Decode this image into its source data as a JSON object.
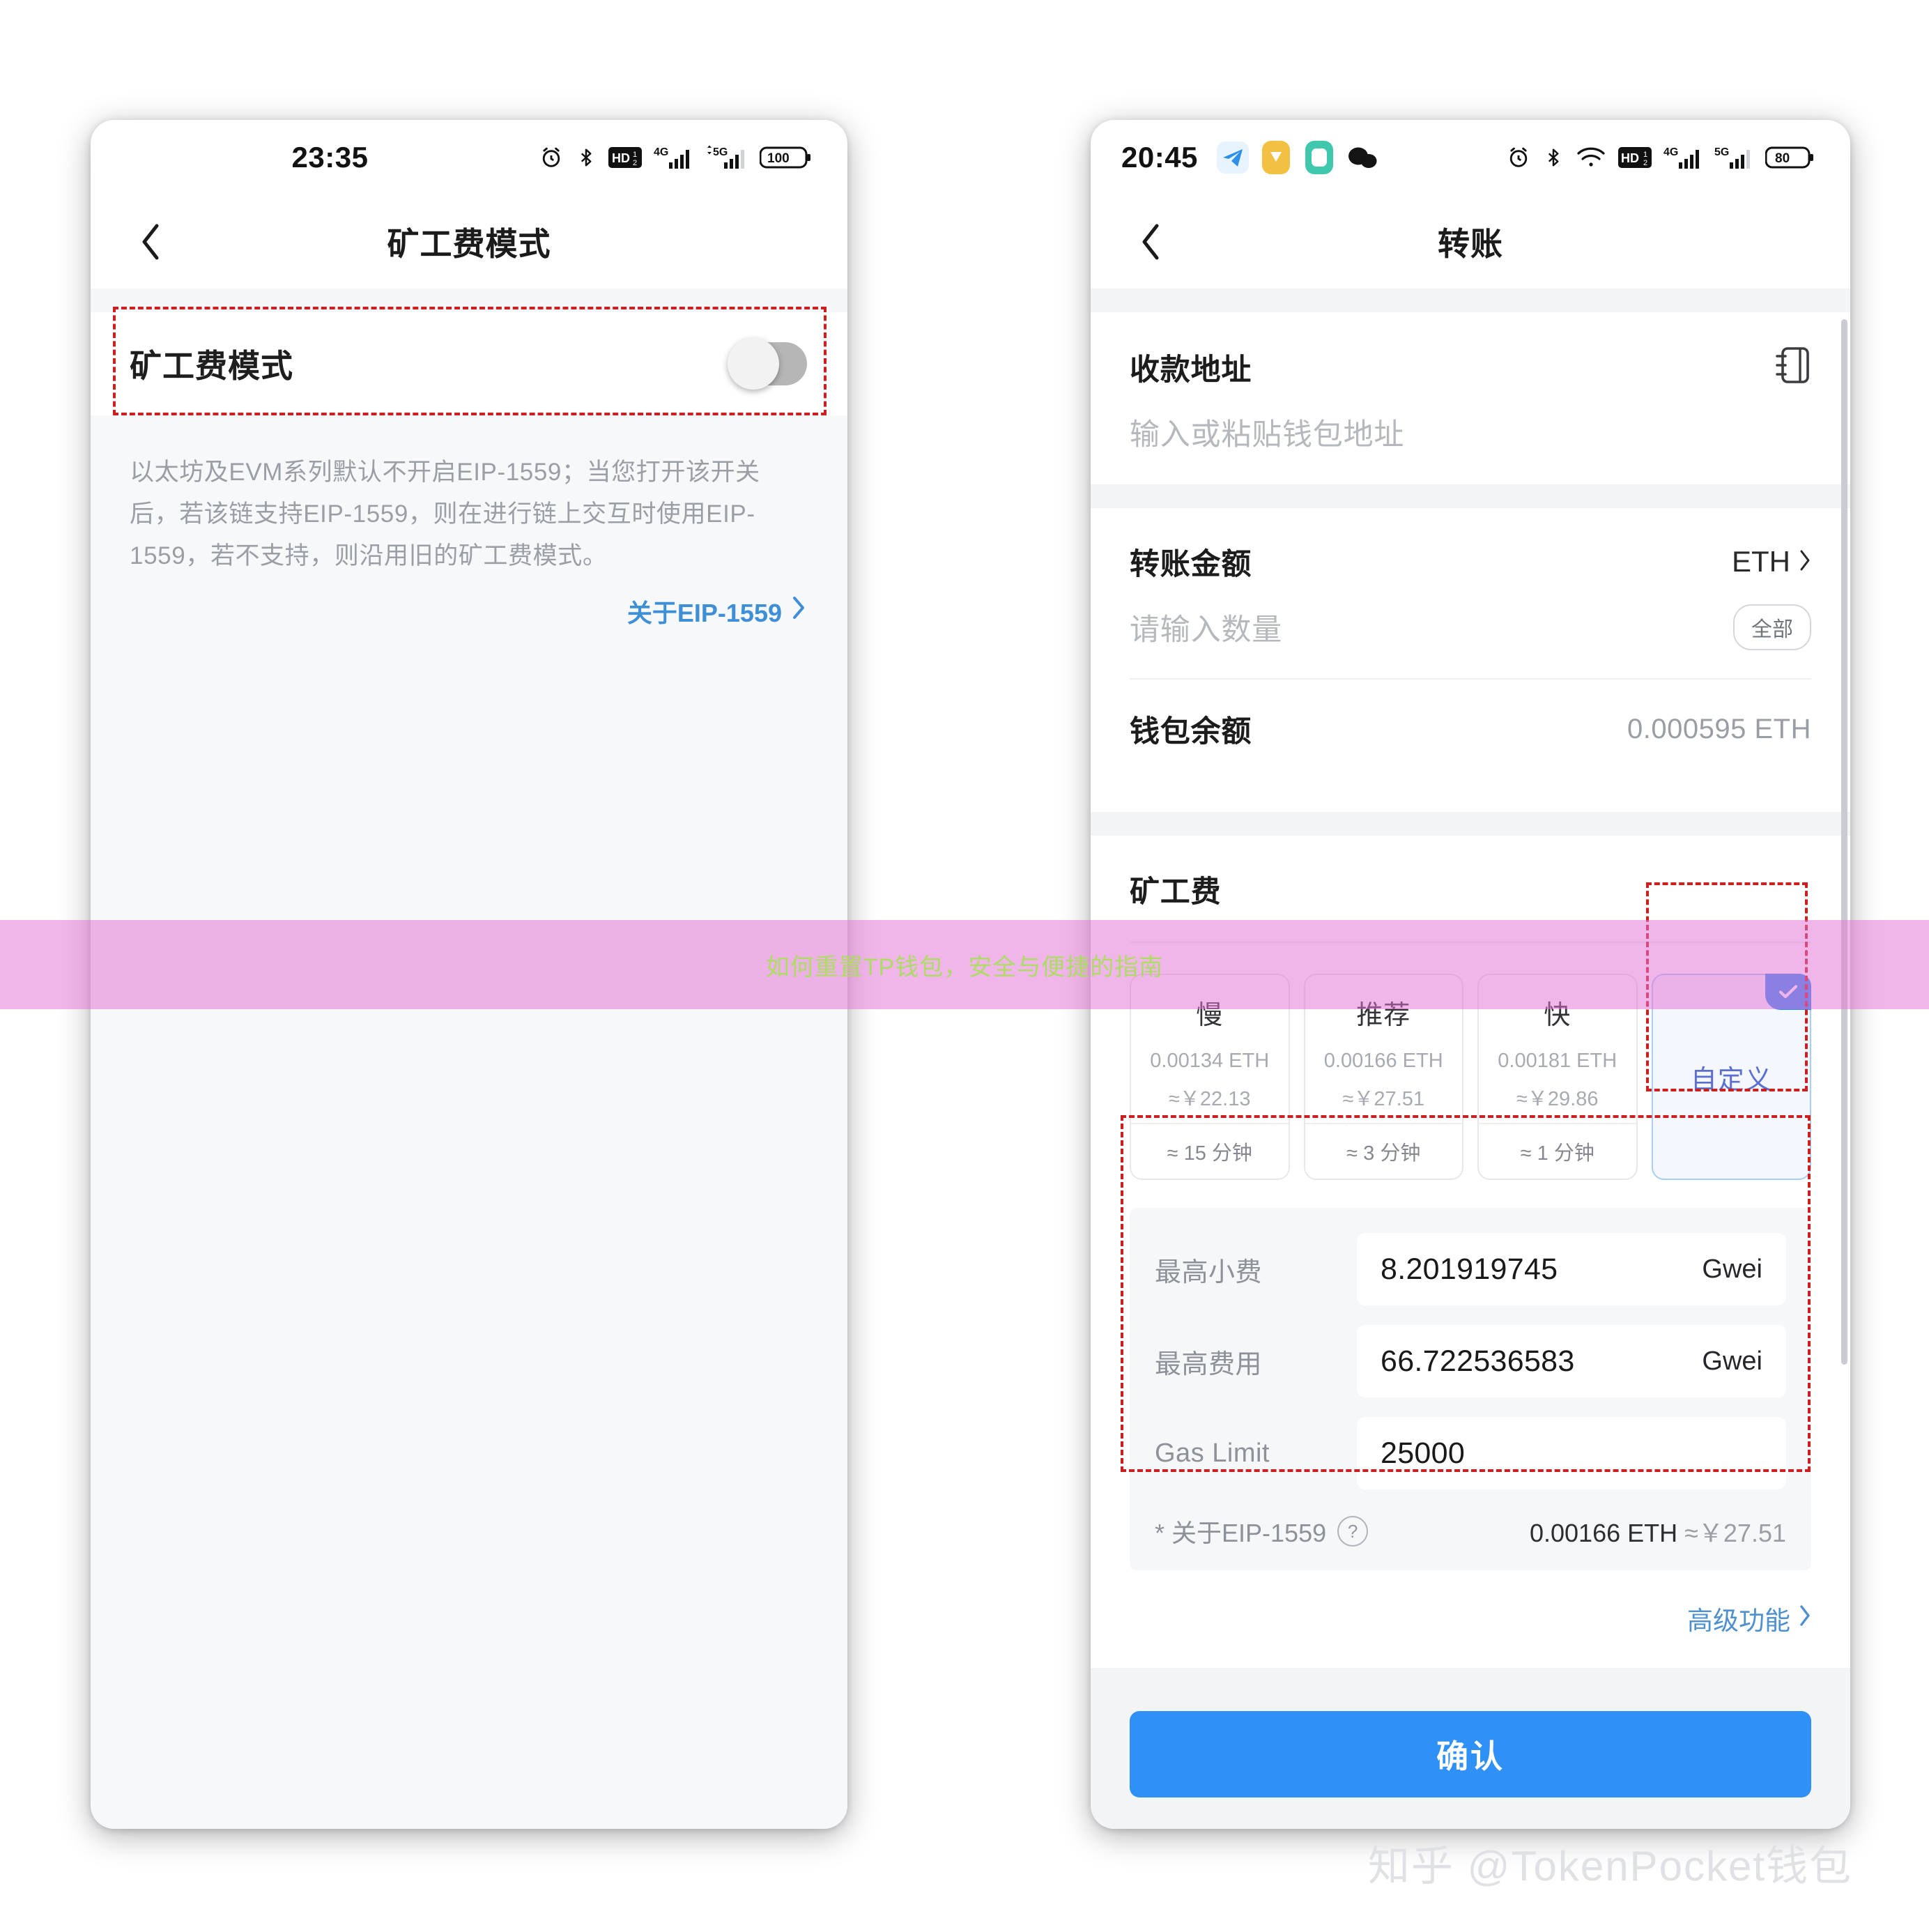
{
  "left_phone": {
    "status_bar": {
      "time": "23:35",
      "icons": [
        "alarm-icon",
        "bluetooth-icon",
        "hd-voice-icon",
        "4g-signal-icon",
        "5g-signal-icon"
      ],
      "battery": "100"
    },
    "nav": {
      "back_icon": "chevron-left-icon",
      "title": "矿工费模式"
    },
    "setting": {
      "label": "矿工费模式",
      "toggle_state": "off"
    },
    "description": "以太坊及EVM系列默认不开启EIP-1559；当您打开该开关后，若该链支持EIP-1559，则在进行链上交互时使用EIP-1559，若不支持，则沿用旧的矿工费模式。",
    "link": {
      "label": "关于EIP-1559",
      "chevron": "chevron-right-icon"
    }
  },
  "right_phone": {
    "status_bar": {
      "time": "20:45",
      "app_icons": [
        "telegram-icon",
        "shield-app-icon",
        "chat-app-icon",
        "wechat-icon"
      ],
      "icons": [
        "alarm-icon",
        "bluetooth-icon",
        "wifi-icon",
        "hd-voice-icon",
        "4g-signal-icon",
        "5g-signal-icon"
      ],
      "battery": "80"
    },
    "nav": {
      "back_icon": "chevron-left-icon",
      "title": "转账"
    },
    "address": {
      "label": "收款地址",
      "placeholder": "输入或粘贴钱包地址",
      "icon": "address-book-icon"
    },
    "amount": {
      "label": "转账金额",
      "token": "ETH",
      "token_chevron": "chevron-right-icon",
      "placeholder": "请输入数量",
      "max_button": "全部"
    },
    "balance": {
      "label": "钱包余额",
      "value": "0.000595 ETH"
    },
    "fee": {
      "title": "矿工费",
      "options": [
        {
          "name": "慢",
          "eth": "0.00134 ETH",
          "cny": "≈￥22.13",
          "time": "≈ 15 分钟",
          "selected": false
        },
        {
          "name": "推荐",
          "eth": "0.00166 ETH",
          "cny": "≈￥27.51",
          "time": "≈ 3 分钟",
          "selected": false
        },
        {
          "name": "快",
          "eth": "0.00181 ETH",
          "cny": "≈￥29.86",
          "time": "≈ 1 分钟",
          "selected": false
        },
        {
          "name": "自定义",
          "eth": "",
          "cny": "",
          "time": "",
          "selected": true
        }
      ],
      "custom": {
        "rows": [
          {
            "label": "最高小费",
            "value": "8.201919745",
            "unit": "Gwei"
          },
          {
            "label": "最高费用",
            "value": "66.722536583",
            "unit": "Gwei"
          },
          {
            "label": "Gas Limit",
            "value": "25000",
            "unit": ""
          }
        ],
        "footer_label": "* 关于EIP-1559",
        "footer_help_icon": "question-circle-icon",
        "footer_eth": "0.00166 ETH",
        "footer_cny": "≈￥27.51"
      },
      "advanced_link": "高级功能",
      "advanced_chevron": "chevron-right-icon"
    },
    "confirm_button": "确认"
  },
  "overlay_banner": {
    "text": "如何重置TP钱包，安全与便捷的指南",
    "band_color": "#e271d4",
    "text_color": "#a8e05a"
  },
  "watermark": "知乎 @TokenPocket钱包",
  "colors": {
    "accent_blue": "#2f90f5",
    "link_blue": "#4f90cf",
    "custom_purple": "#5b6fd0",
    "dashed_red": "#cc1f1f",
    "muted_text": "#9a9fa6"
  }
}
